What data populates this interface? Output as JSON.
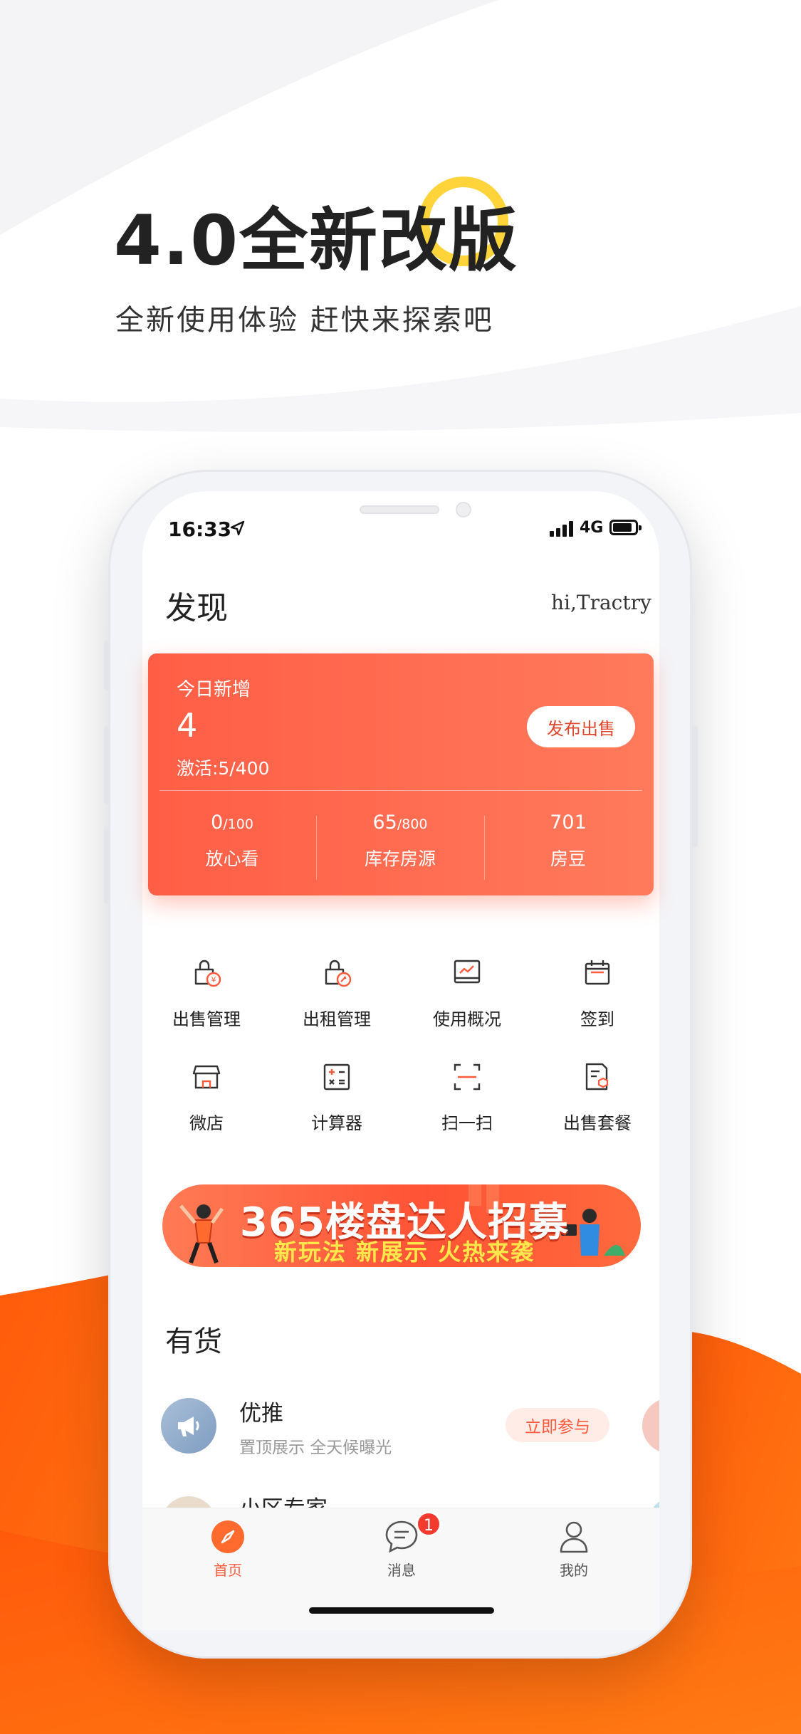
{
  "hero": {
    "title": "4.0全新改版",
    "subtitle": "全新使用体验 赶快来探索吧"
  },
  "status_bar": {
    "time": "16:33",
    "network": "4G"
  },
  "header": {
    "title": "发现",
    "greeting": "hi,Tractry"
  },
  "summary_card": {
    "label": "今日新增",
    "count": "4",
    "active": "激活:5/400",
    "publish_label": "发布出售",
    "stats": [
      {
        "value": "0",
        "total": "/100",
        "label": "放心看"
      },
      {
        "value": "65",
        "total": "/800",
        "label": "库存房源"
      },
      {
        "value": "701",
        "total": "",
        "label": "房豆"
      }
    ]
  },
  "quick_actions": [
    {
      "label": "出售管理",
      "icon": "sale-bag-icon"
    },
    {
      "label": "出租管理",
      "icon": "rent-bag-icon"
    },
    {
      "label": "使用概况",
      "icon": "overview-chart-icon"
    },
    {
      "label": "签到",
      "icon": "calendar-icon"
    },
    {
      "label": "微店",
      "icon": "shop-icon"
    },
    {
      "label": "计算器",
      "icon": "calculator-icon"
    },
    {
      "label": "扫一扫",
      "icon": "scan-icon"
    },
    {
      "label": "出售套餐",
      "icon": "package-doc-icon"
    }
  ],
  "banner": {
    "headline": "365楼盘达人招募",
    "tagline": "新玩法  新展示  火热来袭"
  },
  "goods": {
    "section_title": "有货",
    "items": [
      {
        "title": "优推",
        "desc": "置顶展示 全天候曝光",
        "action": "立即参与",
        "icon": "megaphone-icon"
      },
      {
        "title": "小区专家",
        "desc": "",
        "action": "",
        "icon": "expert-avatar"
      }
    ]
  },
  "tabbar": {
    "tabs": [
      {
        "label": "首页",
        "icon": "compass-icon",
        "active": true
      },
      {
        "label": "消息",
        "icon": "chat-icon",
        "badge": "1"
      },
      {
        "label": "我的",
        "icon": "user-icon"
      }
    ]
  },
  "colors": {
    "accent": "#FF5A3C",
    "card_start": "#FF5E45",
    "card_end": "#FF7A5C",
    "ring": "#FFD43A",
    "wave_orange": "#FF6A0E"
  }
}
